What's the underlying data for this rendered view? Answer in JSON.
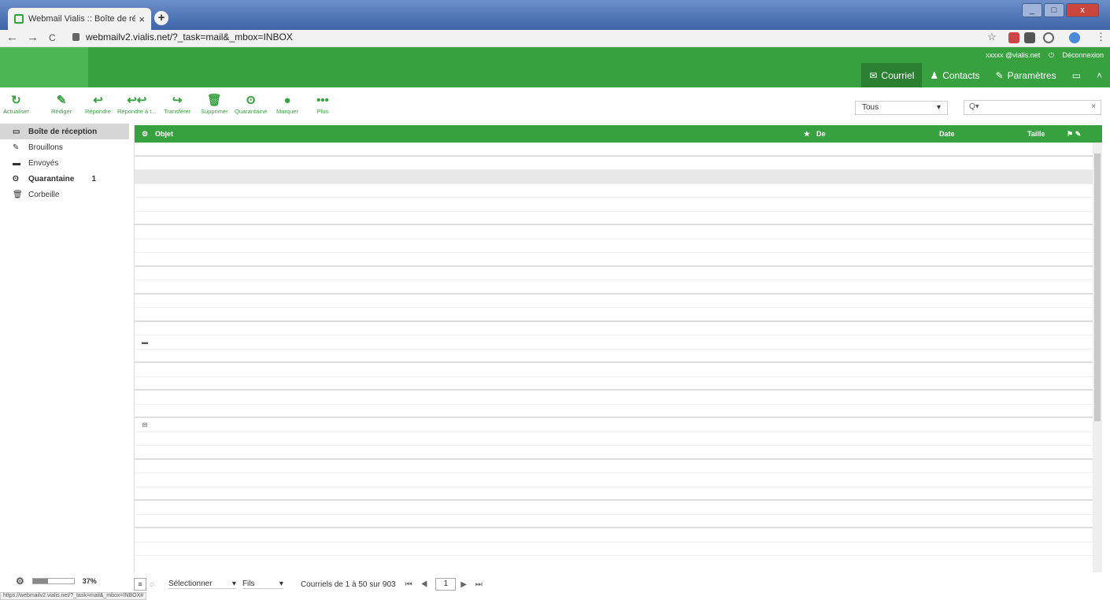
{
  "browser": {
    "tab_title": "Webmail Vialis :: Boîte de récepti",
    "tab_close": "×",
    "new_tab": "+",
    "url": "webmailv2.vialis.net/?_task=mail&_mbox=INBOX",
    "nav_back": "←",
    "nav_forward": "→",
    "nav_reload": "C",
    "bookmark": "☆",
    "menu": "⋮",
    "win_min": "_",
    "win_max": "□",
    "win_close": "x"
  },
  "header": {
    "user": "xxxxx @vialis.net",
    "logout": "Déconnexion",
    "nav": [
      {
        "icon": "✉",
        "label": "Courriel"
      },
      {
        "icon": "♟",
        "label": "Contacts"
      },
      {
        "icon": "✎",
        "label": "Paramètres"
      },
      {
        "icon": "▭",
        "label": ""
      },
      {
        "icon": "˄",
        "label": ""
      }
    ]
  },
  "toolbar": {
    "buttons": [
      {
        "icon": "↻",
        "label": "Actualiser"
      },
      {
        "icon": "✎",
        "label": "Rédiger"
      },
      {
        "icon": "↩",
        "label": "Répondre"
      },
      {
        "icon": "↩↩",
        "label": "Répondre à t..."
      },
      {
        "icon": "↪",
        "label": "Transférer"
      },
      {
        "icon": "🗑",
        "label": "Supprimer"
      },
      {
        "icon": "ʘ",
        "label": "Quarantaine"
      },
      {
        "icon": "●",
        "label": "Marquer"
      },
      {
        "icon": "•••",
        "label": "Plus"
      }
    ],
    "filter_value": "Tous",
    "filter_caret": "▾",
    "search_placeholder": "Q▾",
    "search_clear": "×"
  },
  "folders": [
    {
      "icon": "▭",
      "label": "Boîte de réception",
      "count": ""
    },
    {
      "icon": "✎",
      "label": "Brouillons",
      "count": ""
    },
    {
      "icon": "▬",
      "label": "Envoyés",
      "count": ""
    },
    {
      "icon": "ʘ",
      "label": "Quarantaine",
      "count": "1"
    },
    {
      "icon": "🗑",
      "label": "Corbeille",
      "count": ""
    }
  ],
  "quota": {
    "percent_label": "37%",
    "fraction": 0.37,
    "gear": "⚙"
  },
  "list": {
    "headers": {
      "icon": "⚙",
      "subject": "Objet",
      "star": "★",
      "from": "De",
      "date": "Date",
      "size": "Taille",
      "flags": "⚑ ✎"
    },
    "rows": [
      {
        "icon": "",
        "subject": "",
        "from": "",
        "date": "",
        "size": "",
        "flag": "",
        "sep": true
      },
      {
        "icon": "",
        "subject": "",
        "from": "",
        "date": "",
        "size": "",
        "flag": ""
      },
      {
        "icon": "",
        "subject": "",
        "from": "",
        "date": "",
        "size": "",
        "flag": "",
        "selected": true
      },
      {
        "icon": "",
        "subject": "",
        "from": "",
        "date": "",
        "size": "",
        "flag": ""
      },
      {
        "icon": "",
        "subject": "",
        "from": "",
        "date": "",
        "size": "",
        "flag": ""
      },
      {
        "icon": "",
        "subject": "",
        "from": "",
        "date": "",
        "size": "",
        "flag": "",
        "sep": true
      },
      {
        "icon": "",
        "subject": "",
        "from": "",
        "date": "",
        "size": "",
        "flag": ""
      },
      {
        "icon": "",
        "subject": "",
        "from": "",
        "date": "",
        "size": "",
        "flag": ""
      },
      {
        "icon": "",
        "subject": "",
        "from": "",
        "date": "",
        "size": "",
        "flag": "",
        "sep": true
      },
      {
        "icon": "",
        "subject": "",
        "from": "",
        "date": "",
        "size": "",
        "flag": ""
      },
      {
        "icon": "",
        "subject": "",
        "from": "",
        "date": "",
        "size": "",
        "flag": "",
        "sep": true
      },
      {
        "icon": "",
        "subject": "",
        "from": "",
        "date": "",
        "size": "",
        "flag": ""
      },
      {
        "icon": "",
        "subject": "",
        "from": "",
        "date": "",
        "size": "",
        "flag": "",
        "sep": true
      },
      {
        "icon": "",
        "subject": "",
        "from": "",
        "date": "",
        "size": "",
        "flag": ""
      },
      {
        "icon": "▬",
        "subject": "",
        "from": "",
        "date": "",
        "size": "",
        "flag": ""
      },
      {
        "icon": "",
        "subject": "",
        "from": "",
        "date": "",
        "size": "",
        "flag": "",
        "sep": true
      },
      {
        "icon": "",
        "subject": "",
        "from": "",
        "date": "",
        "size": "",
        "flag": ""
      },
      {
        "icon": "",
        "subject": "",
        "from": "",
        "date": "",
        "size": "",
        "flag": "",
        "sep": true
      },
      {
        "icon": "",
        "subject": "",
        "from": "",
        "date": "",
        "size": "",
        "flag": ""
      },
      {
        "icon": "",
        "subject": "",
        "from": "",
        "date": "",
        "size": "",
        "flag": "",
        "sep": true
      },
      {
        "icon": "⊟",
        "subject": "",
        "from": "",
        "date": "",
        "size": "",
        "flag": ""
      },
      {
        "icon": "",
        "subject": "",
        "from": "",
        "date": "",
        "size": "",
        "flag": ""
      },
      {
        "icon": "",
        "subject": "",
        "from": "",
        "date": "",
        "size": "",
        "flag": "",
        "sep": true
      },
      {
        "icon": "",
        "subject": "",
        "from": "",
        "date": "",
        "size": "",
        "flag": ""
      },
      {
        "icon": "",
        "subject": "",
        "from": "",
        "date": "",
        "size": "",
        "flag": ""
      },
      {
        "icon": "",
        "subject": "",
        "from": "",
        "date": "",
        "size": "",
        "flag": "",
        "sep": true
      },
      {
        "icon": "",
        "subject": "",
        "from": "",
        "date": "",
        "size": "",
        "flag": ""
      },
      {
        "icon": "",
        "subject": "",
        "from": "",
        "date": "",
        "size": "",
        "flag": "",
        "sep": true
      },
      {
        "icon": "",
        "subject": "",
        "from": "",
        "date": "",
        "size": "",
        "flag": ""
      },
      {
        "icon": "",
        "subject": "",
        "from": "",
        "date": "",
        "size": "",
        "flag": ""
      }
    ]
  },
  "footer": {
    "list_btn": "≡",
    "thread_btn": "◌",
    "select_label": "Sélectionner",
    "thread_label": "Fils",
    "caret": "▾",
    "count_label": "Courriels de 1 à 50 sur 903",
    "first_prev": "⏮ ◀",
    "page": "1",
    "next_last": "▶ ⏭"
  },
  "status_url": "https://webmailv2.vialis.net/?_task=mail&_mbox=INBOX#"
}
